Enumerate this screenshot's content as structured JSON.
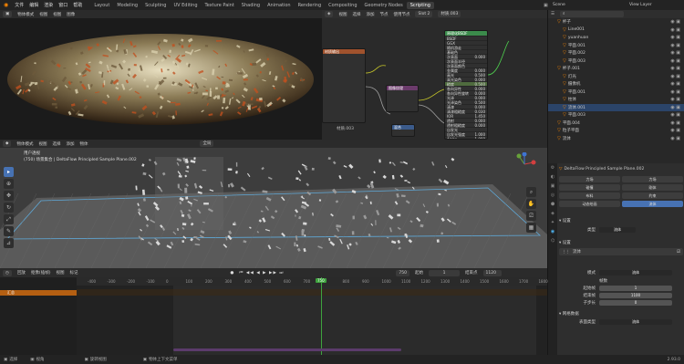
{
  "topbar": {
    "menus": [
      "文件",
      "编辑",
      "渲染",
      "窗口",
      "帮助"
    ],
    "workspaces": [
      "Layout",
      "Modeling",
      "Sculpting",
      "UV Editing",
      "Texture Paint",
      "Shading",
      "Animation",
      "Rendering",
      "Compositing",
      "Geometry Nodes",
      "Scripting"
    ],
    "active_workspace": "Scripting",
    "scene_label": "Scene",
    "view_layer": "View Layer"
  },
  "image_editor": {
    "header": [
      "视图",
      "视图",
      "图像"
    ],
    "mode": "物体模式"
  },
  "node_editor": {
    "header": [
      "视图",
      "选择",
      "添加",
      "节点",
      "使用节点"
    ],
    "slot": "Slot 2",
    "material": "材质.003",
    "node_left_title": "材质输出",
    "node_principled_title": "原理化BSDF",
    "principled_rows": [
      "BSDF",
      "GGX",
      "随机游走",
      "基础色",
      "次表面",
      "次表面半径",
      "次表面颜色",
      "金属度",
      "高光",
      "高光染色",
      "糙度",
      "各向异性",
      "各向异性旋转",
      "光泽",
      "光泽染色",
      "清漆",
      "清漆粗糙度",
      "IOR",
      "透射",
      "透射粗糙度",
      "自发光",
      "自发光强度",
      "Alpha",
      "法向",
      "清漆法线",
      "切向"
    ],
    "principled_values": [
      "",
      "",
      "",
      "",
      "0.000",
      "",
      "",
      "0.000",
      "0.500",
      "0.000",
      "0.500",
      "0.000",
      "0.000",
      "0.000",
      "0.500",
      "0.000",
      "0.030",
      "1.450",
      "0.000",
      "0.000",
      "",
      "1.000",
      "1.000",
      "",
      "",
      ""
    ],
    "node_mid_title": "图像纹理",
    "node_out_title": "材质输出",
    "node_small_title": "混合",
    "bottom_label": "材质.003"
  },
  "viewport": {
    "header_items": [
      "物体模式",
      "视图",
      "选择",
      "添加",
      "物体"
    ],
    "global": "全局",
    "info_line1": "用户透视",
    "info_line2": "(750) 场景集合 | DeltaFlow Principled Sample Plane.002"
  },
  "outliner": {
    "title": "Scene",
    "rows": [
      {
        "label": "杯子",
        "icon": "▽",
        "indent": 1,
        "sel": false
      },
      {
        "label": "Line001",
        "icon": "▽",
        "indent": 2,
        "sel": false
      },
      {
        "label": "yuanhuan",
        "icon": "▽",
        "indent": 2,
        "sel": false
      },
      {
        "label": "平面.001",
        "icon": "▽",
        "indent": 2,
        "sel": false
      },
      {
        "label": "平面.002",
        "icon": "▽",
        "indent": 2,
        "sel": false
      },
      {
        "label": "平面.003",
        "icon": "▽",
        "indent": 2,
        "sel": false
      },
      {
        "label": "杯子.001",
        "icon": "▽",
        "indent": 1,
        "sel": false
      },
      {
        "label": "灯光",
        "icon": "▽",
        "indent": 2,
        "sel": false
      },
      {
        "label": "摄像机",
        "icon": "▽",
        "indent": 2,
        "sel": false
      },
      {
        "label": "平面.001",
        "icon": "▽",
        "indent": 2,
        "sel": false
      },
      {
        "label": "柱体",
        "icon": "▽",
        "indent": 2,
        "sel": false
      },
      {
        "label": "流体.001",
        "icon": "▽",
        "indent": 2,
        "sel": true
      },
      {
        "label": "平面.003",
        "icon": "▽",
        "indent": 2,
        "sel": false
      },
      {
        "label": "平面.004",
        "icon": "▽",
        "indent": 1,
        "sel": false
      },
      {
        "label": "粒子平面",
        "icon": "▽",
        "indent": 1,
        "sel": false
      },
      {
        "label": "流体",
        "icon": "▽",
        "indent": 1,
        "sel": false
      }
    ]
  },
  "properties": {
    "object_name": "DeltaFlow Principled Sample Plane.002",
    "tabs": [
      "力场",
      "力场",
      "碰撞",
      "刚体",
      "布料",
      "约束",
      "动态绘画",
      "流体"
    ],
    "section_settings": "设置",
    "type_label": "类型",
    "type_value": "流体",
    "panel_flow": "流体",
    "sub_label": "设置",
    "mode_label": "模式",
    "mode_value": "流体",
    "frame_label": "帧数",
    "fields": [
      {
        "label": "起始帧",
        "value": "1"
      },
      {
        "label": "结束帧",
        "value": "1100"
      },
      {
        "label": "子步长",
        "value": "0"
      }
    ],
    "bottom_section": "网格数据",
    "bottom_field": "表面类型",
    "bottom_value": "流体"
  },
  "timeline": {
    "header_items": [
      "回放",
      "抠像(插帧)",
      "视图",
      "标记"
    ],
    "current_frame": "750",
    "start_label": "起始",
    "start": "1",
    "end_label": "结束点",
    "end": "1120",
    "ticks": [
      "-400",
      "-300",
      "-200",
      "-100",
      "0",
      "100",
      "200",
      "300",
      "400",
      "500",
      "600",
      "700",
      "750",
      "800",
      "900",
      "1000",
      "1100",
      "1200",
      "1300",
      "1400",
      "1500",
      "1600",
      "1700",
      "1800"
    ],
    "track": "汇总"
  },
  "statusbar": {
    "items": [
      "选择",
      "视角",
      "旋转视图",
      "物体上下文菜单"
    ],
    "version": "2.93.0"
  },
  "colors": {
    "accent": "#4772b3",
    "playhead": "#3ea33e",
    "node_green": "#4f6b3e",
    "orange": "#ff8800"
  }
}
